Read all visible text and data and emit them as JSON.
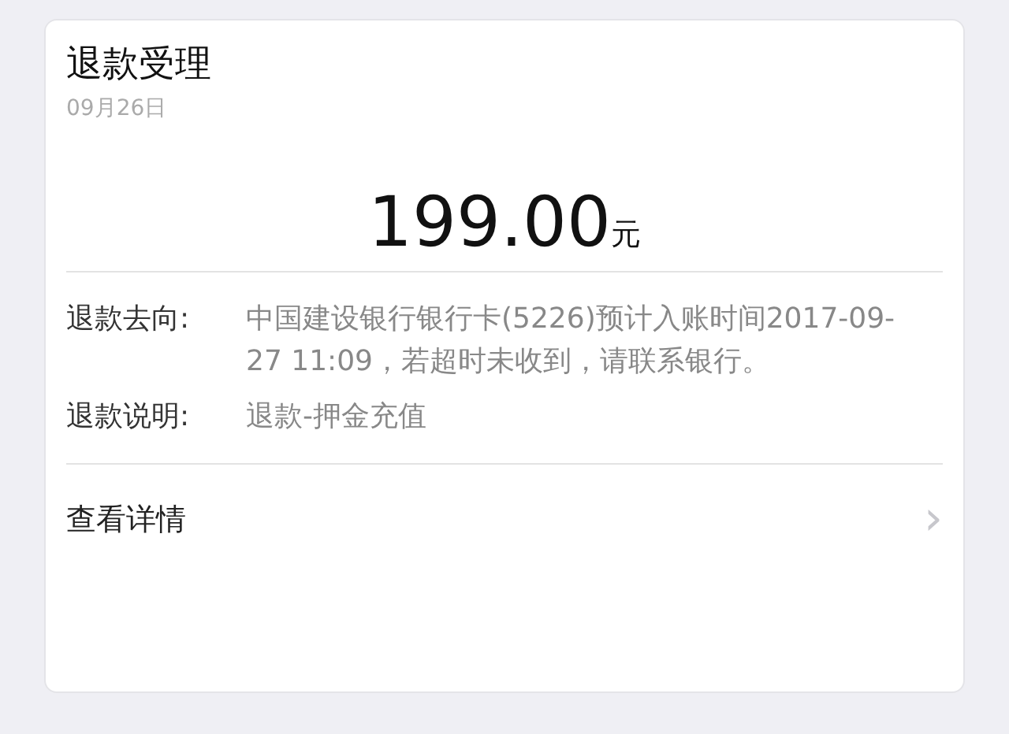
{
  "card": {
    "title": "退款受理",
    "date": "09月26日",
    "amount": "199.00",
    "currency": "元",
    "details": [
      {
        "label": "退款去向:",
        "value": "中国建设银行银行卡(5226)预计入账时间2017-09-27 11:09，若超时未收到，请联系银行。"
      },
      {
        "label": "退款说明:",
        "value": "退款-押金充值"
      }
    ],
    "link": {
      "label": "查看详情",
      "icon": "›"
    }
  }
}
